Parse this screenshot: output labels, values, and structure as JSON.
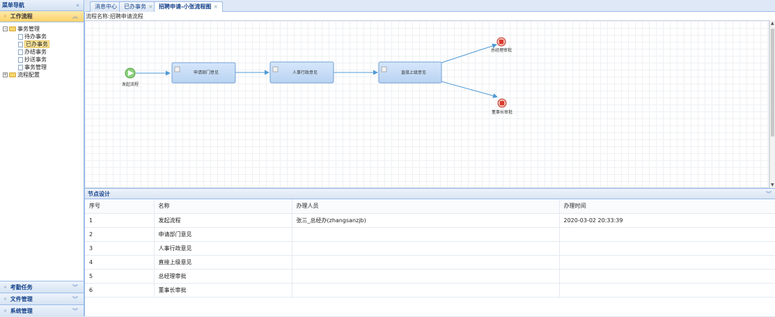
{
  "sidebar": {
    "title": "菜单导航",
    "collapse_glyph": "«",
    "active_section": {
      "label": "工作流程",
      "chevron": "︽"
    },
    "tree": {
      "root1": "事务管理",
      "children": [
        "待办事务",
        "已办事务",
        "办结事务",
        "抄送事务",
        "事务管理"
      ],
      "root2": "流程配置",
      "selected": "已办事务"
    },
    "bottom_sections": [
      {
        "label": "考勤任务",
        "chevron": "︾"
      },
      {
        "label": "文件管理",
        "chevron": "︾"
      },
      {
        "label": "系统管理",
        "chevron": "︾"
      }
    ]
  },
  "tabs": [
    {
      "label": "消息中心",
      "closable": false
    },
    {
      "label": "已办事务",
      "closable": true
    },
    {
      "label": "招聘申请-小张流程图",
      "closable": true,
      "active": true
    }
  ],
  "flow": {
    "name_label": "流程名称:",
    "name_value": "招聘申请流程",
    "nodes": {
      "start": "发起流程",
      "dept": "申请部门意见",
      "hr": "人事行政意见",
      "sup": "直接上级意见",
      "gm": "总经理审批",
      "ceo": "董事长审批"
    }
  },
  "node_panel": {
    "title": "节点设计",
    "chevron": "︾",
    "columns": [
      "序号",
      "名称",
      "办理人员",
      "办理时间"
    ],
    "rows": [
      [
        "1",
        "发起流程",
        "张三_总经办(zhangsanzjb)",
        "2020-03-02 20:33:39"
      ],
      [
        "2",
        "申请部门意见",
        "",
        ""
      ],
      [
        "3",
        "人事行政意见",
        "",
        ""
      ],
      [
        "4",
        "直接上级意见",
        "",
        ""
      ],
      [
        "5",
        "总经理审批",
        "",
        ""
      ],
      [
        "6",
        "董事长审批",
        "",
        ""
      ]
    ]
  },
  "colors": {
    "accent_blue": "#99bbe8",
    "header_text": "#15428b",
    "active_section": "#fdd36b",
    "task_fill": "#c5dcf7",
    "start_green": "#7cc576",
    "end_red": "#e8493b",
    "edge_blue": "#4f9ad6"
  },
  "icons": {
    "collapse": "double-chevron-left-icon",
    "expand_down": "double-chevron-down-icon",
    "folder": "folder-icon",
    "file": "file-icon",
    "start": "play-icon",
    "end": "stop-icon",
    "task": "user-task-icon"
  }
}
